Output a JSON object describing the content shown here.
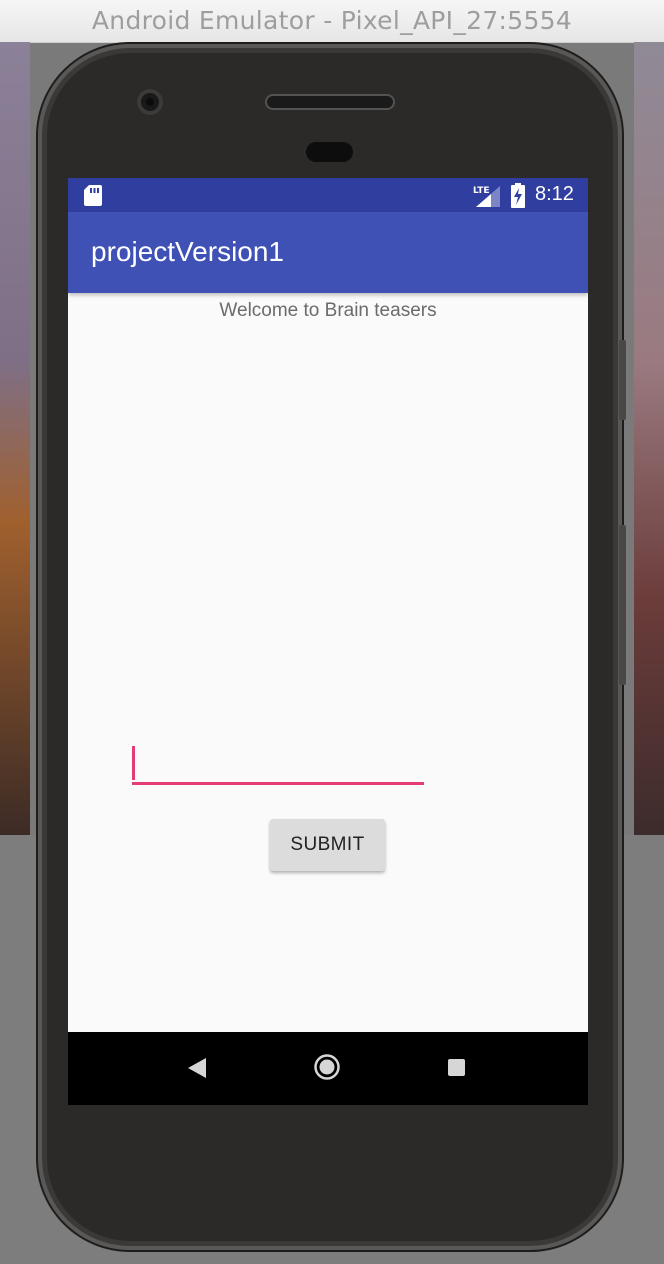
{
  "window": {
    "title": "Android Emulator - Pixel_API_27:5554"
  },
  "status_bar": {
    "time": "8:12",
    "icons": [
      "sd-card-icon",
      "lte-signal-icon",
      "battery-charging-icon"
    ],
    "network_label": "LTE"
  },
  "app_bar": {
    "title": "projectVersion1",
    "color": "#3f51b5",
    "status_color": "#303f9f"
  },
  "content": {
    "welcome_text": "Welcome to Brain teasers",
    "input": {
      "value": "",
      "placeholder": "",
      "accent_color": "#e63c74"
    },
    "submit_label": "SUBMIT"
  },
  "navigation_bar": {
    "buttons": [
      "back-icon",
      "home-icon",
      "recents-icon"
    ]
  }
}
